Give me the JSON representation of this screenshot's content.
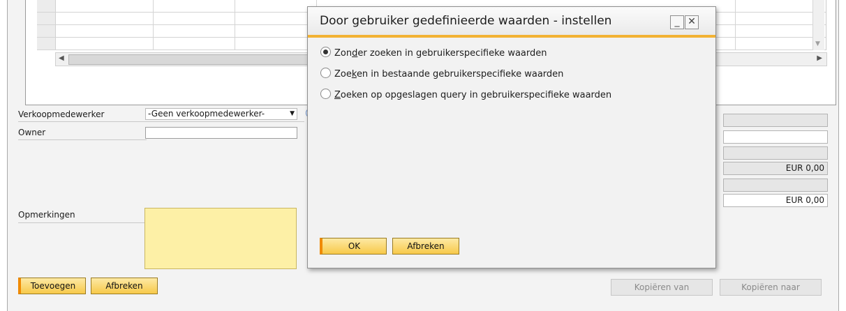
{
  "form": {
    "sales_employee_label": "Verkoopmedewerker",
    "sales_employee_value": "-Geen verkoopmedewerker-",
    "owner_label": "Owner",
    "owner_value": "",
    "remarks_label": "Opmerkingen",
    "remarks_value": "",
    "add_button": "Toevoegen",
    "cancel_button": "Afbreken",
    "copy_from_button": "Kopiëren van",
    "copy_to_button": "Kopiëren naar"
  },
  "totals": {
    "fields": [
      "",
      "",
      "",
      "EUR 0,00",
      "",
      "EUR 0,00"
    ]
  },
  "dialog": {
    "title": "Door gebruiker gedefinieerde waarden - instellen",
    "minimize_glyph": "_",
    "close_glyph": "✕",
    "options": [
      {
        "label_pre": "Zon",
        "accesskey": "d",
        "label_post": "er zoeken in gebruikerspecifieke waarden",
        "selected": true
      },
      {
        "label_pre": "Zoe",
        "accesskey": "k",
        "label_post": "en in bestaande gebruikerspecifieke waarden",
        "selected": false
      },
      {
        "label_pre": "",
        "accesskey": "Z",
        "label_post": "oeken op opgeslagen query in gebruikerspecifieke waarden",
        "selected": false
      }
    ],
    "ok_button": "OK",
    "cancel_button": "Afbreken"
  },
  "colors": {
    "accent_yellow": "#f7c94a",
    "accent_orange": "#f08a00",
    "remarks_bg": "#fdf0a6"
  }
}
